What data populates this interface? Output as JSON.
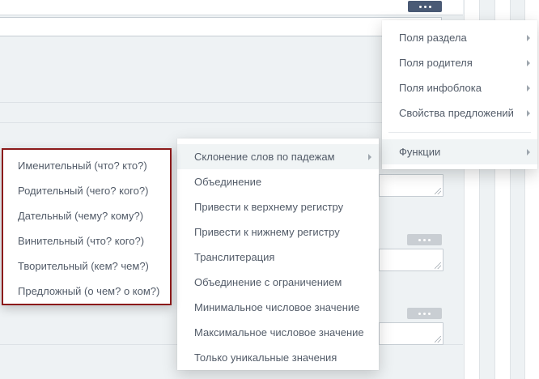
{
  "colors": {
    "background": "#eef2f4",
    "menu_text": "#535c69",
    "active_item_bg": "#f0f4f5",
    "highlight_border": "#8b1a1a",
    "dots_button_dark": "#4a5a75",
    "dots_button_grey": "#c9ced3"
  },
  "icons": {
    "more_button": "ellipsis-icon",
    "submenu_arrow": "chevron-right-icon",
    "resize_grip": "resize-grip-icon"
  },
  "fields_menu": {
    "items": [
      {
        "label": "Поля раздела",
        "has_submenu": true
      },
      {
        "label": "Поля родителя",
        "has_submenu": true
      },
      {
        "label": "Поля инфоблока",
        "has_submenu": true
      },
      {
        "label": "Свойства предложений",
        "has_submenu": true
      }
    ],
    "functions": {
      "label": "Функции",
      "has_submenu": true,
      "active": true
    }
  },
  "functions_menu": {
    "items": [
      {
        "label": "Склонение слов по падежам",
        "has_submenu": true,
        "active": true
      },
      {
        "label": "Объединение"
      },
      {
        "label": "Привести к верхнему регистру"
      },
      {
        "label": "Привести к нижнему регистру"
      },
      {
        "label": "Транслитерация"
      },
      {
        "label": "Объединение с ограничением"
      },
      {
        "label": "Минимальное числовое значение"
      },
      {
        "label": "Максимальное числовое значение"
      },
      {
        "label": "Только уникальные значения"
      }
    ]
  },
  "cases_menu": {
    "items": [
      {
        "label": "Именительный (что? кто?)"
      },
      {
        "label": "Родительный (чего? кого?)"
      },
      {
        "label": "Дательный (чему? кому?)"
      },
      {
        "label": "Винительный (что? кого?)"
      },
      {
        "label": "Творительный (кем? чем?)"
      },
      {
        "label": "Предложный (о чем? о ком?)"
      }
    ]
  }
}
